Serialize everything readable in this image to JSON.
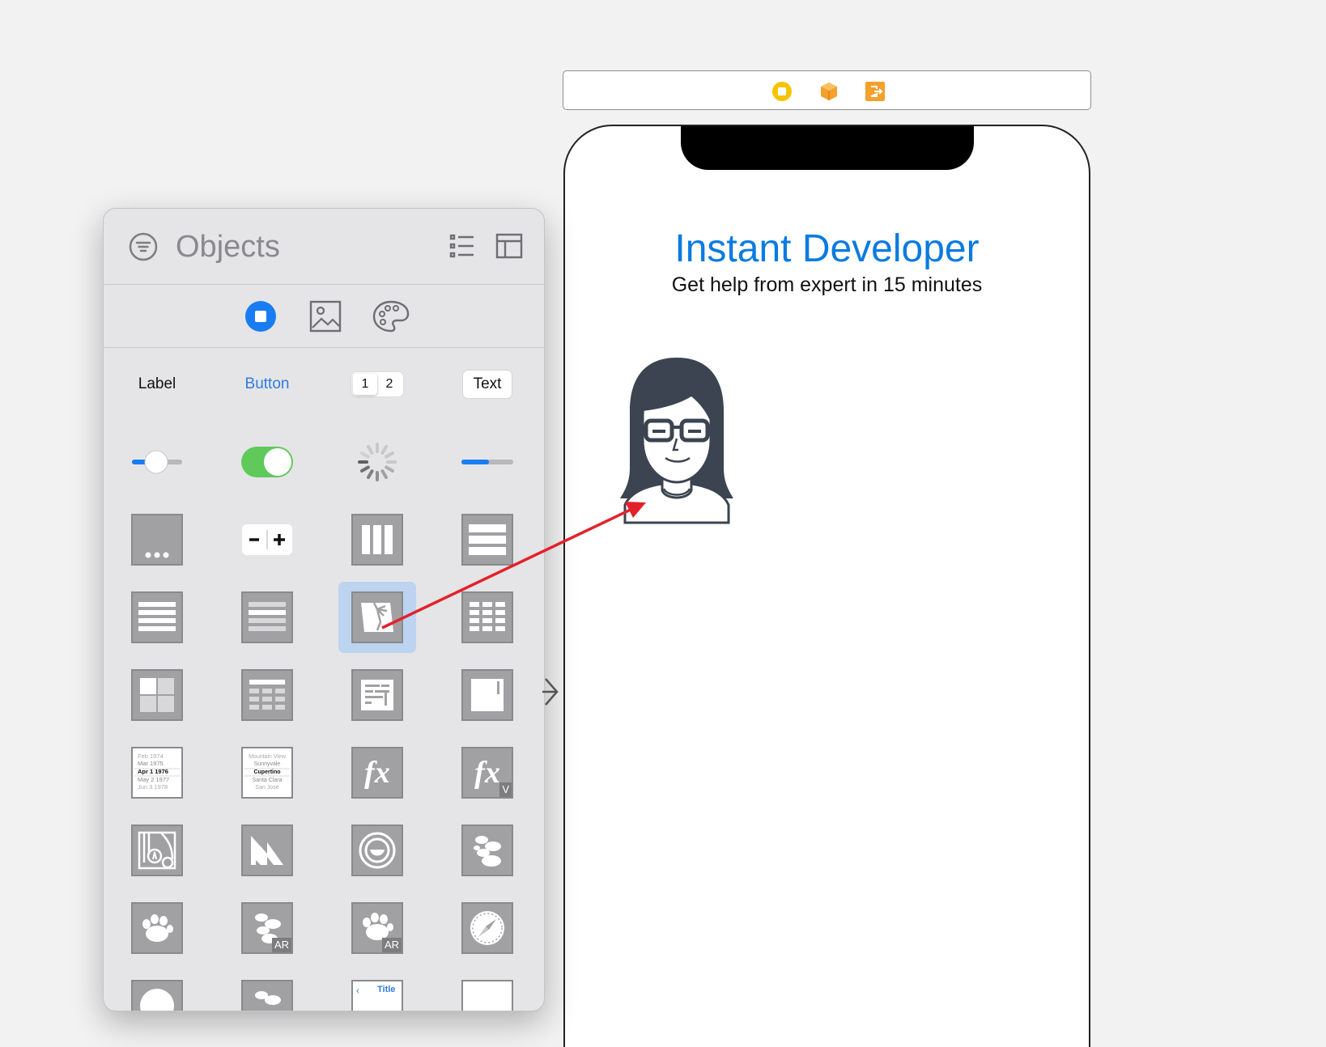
{
  "objects_panel": {
    "search_placeholder": "Objects",
    "grid": {
      "label_text": "Label",
      "button_text": "Button",
      "segment_1": "1",
      "segment_2": "2",
      "text_field_text": "Text",
      "picker_values_left": [
        "Feb 1974",
        "Mar 1975",
        "Apr 1 1976",
        "May 2 1977",
        "Jun 3 1978"
      ],
      "picker_values_right": [
        "Mountain View",
        "Sunnyvale",
        "Cupertino",
        "Santa Clara",
        "San Jose"
      ],
      "fx_text": "fx",
      "fx_v_badge": "V",
      "ar_badge": "AR",
      "nav_title": "Title"
    }
  },
  "phone": {
    "title": "Instant Developer",
    "subtitle": "Get help from expert in 15 minutes"
  },
  "colors": {
    "accent": "#0a7be0",
    "arrow": "#e3212b",
    "switch_on": "#5fc95a",
    "segment_active": "#1a7cf2"
  }
}
